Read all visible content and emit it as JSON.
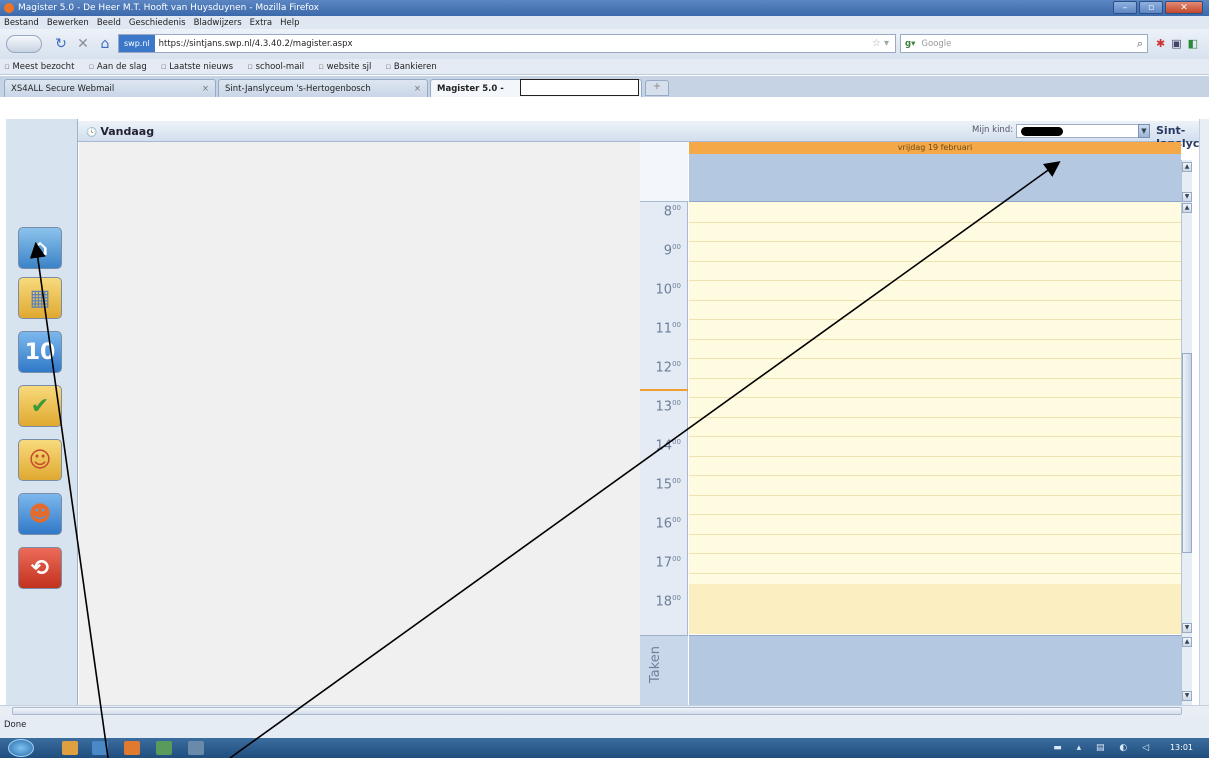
{
  "window": {
    "title": "Magister 5.0 - De Heer M.T. Hooft van Huysduynen - Mozilla Firefox",
    "controls": [
      "–",
      "▫",
      "✕"
    ]
  },
  "menu": [
    "Bestand",
    "Bewerken",
    "Beeld",
    "Geschiedenis",
    "Bladwijzers",
    "Extra",
    "Help"
  ],
  "nav": {
    "site_badge": "swp.nl",
    "url": "https://sintjans.swp.nl/4.3.40.2/magister.aspx",
    "search_engine": "Google"
  },
  "bookmarks": [
    "Meest bezocht",
    "Aan de slag",
    "Laatste nieuws",
    "school-mail",
    "website sjl",
    "Bankieren"
  ],
  "tabs": [
    {
      "label": "XS4ALL Secure Webmail"
    },
    {
      "label": "Sint-Janslyceum 's-Hertogenbosch"
    },
    {
      "label": "Magister 5.0 -"
    }
  ],
  "app": {
    "section_title": "Vandaag",
    "child_label": "Mijn kind:",
    "school_name": "Sint-Janslyceum",
    "day_header": "vrijdag 19 februari",
    "hours": [
      {
        "h": "8",
        "m": "00"
      },
      {
        "h": "9",
        "m": "00"
      },
      {
        "h": "10",
        "m": "00"
      },
      {
        "h": "11",
        "m": "00"
      },
      {
        "h": "12",
        "m": "00"
      },
      {
        "h": "13",
        "m": "00"
      },
      {
        "h": "14",
        "m": "00"
      },
      {
        "h": "15",
        "m": "00"
      },
      {
        "h": "16",
        "m": "00"
      },
      {
        "h": "17",
        "m": "00"
      },
      {
        "h": "18",
        "m": "00"
      }
    ],
    "tasks_label": "Taken",
    "sidebar_icons": [
      "home-icon",
      "agenda-icon",
      "grades-icon",
      "attendance-icon",
      "contacts-icon",
      "profile-icon",
      "logout-icon"
    ],
    "grades_icon_text": "10"
  },
  "status": {
    "text": "Done",
    "clock": "13:01"
  },
  "colors": {
    "day_header": "#f5a847",
    "slot_background": "#fffbe0",
    "allday_background": "#b5c8e2"
  }
}
